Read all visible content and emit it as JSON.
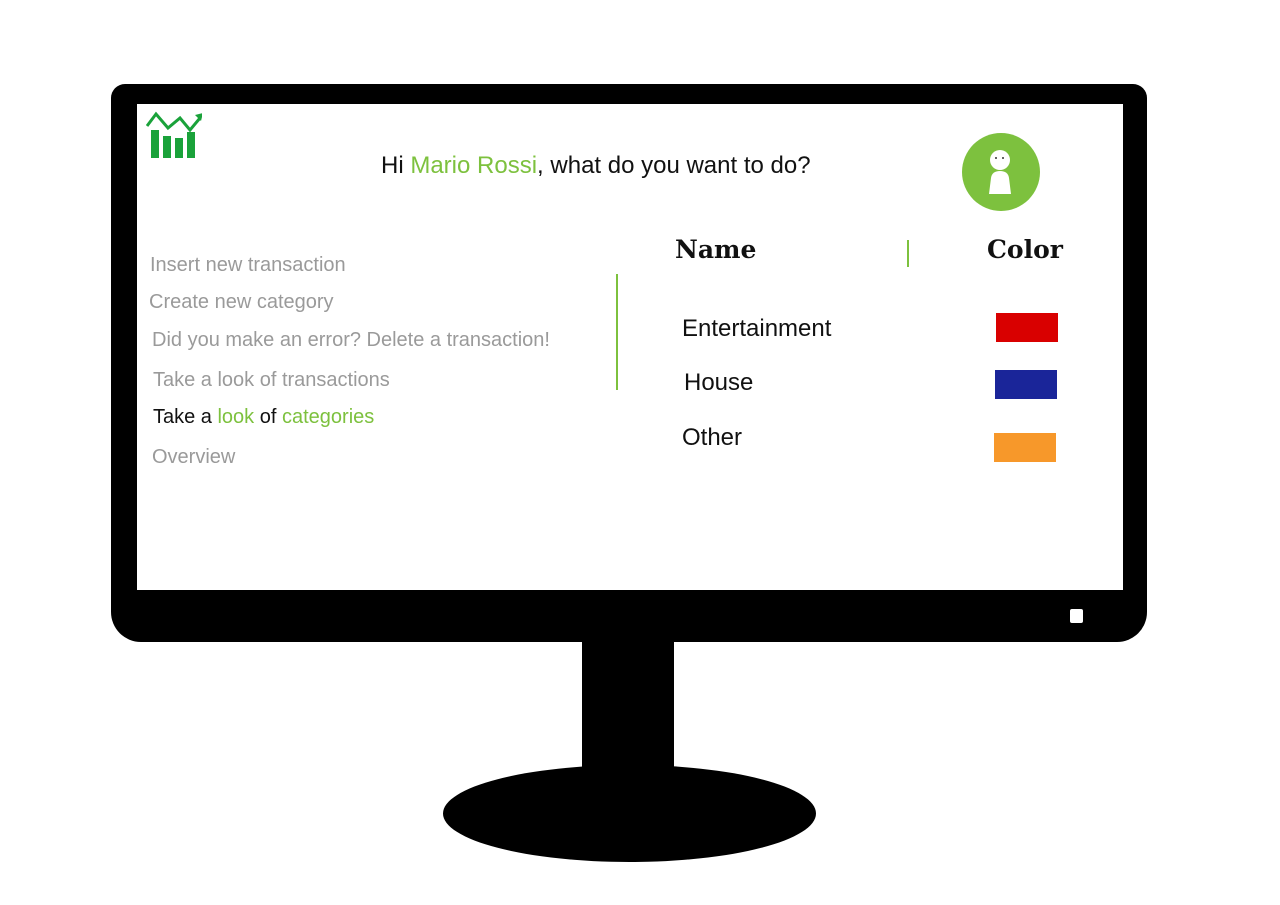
{
  "app": {
    "logo_icon": "bar-chart-growth-icon",
    "accent_color": "#7dc13e"
  },
  "header": {
    "greeting_prefix": "Hi ",
    "user_name": "Mario Rossi",
    "greeting_suffix": ", what do you want to do?",
    "avatar_icon": "user-avatar-icon"
  },
  "menu": {
    "items": [
      {
        "label": "Insert new transaction"
      },
      {
        "label": "Create new category"
      },
      {
        "label": "Did you make an error? Delete a transaction!"
      },
      {
        "label": "Take a look of transactions"
      },
      {
        "label_part1": "Take a ",
        "label_part2": "look",
        "label_part3": " of ",
        "label_part4": "categories",
        "active": true
      },
      {
        "label": "Overview"
      }
    ]
  },
  "table": {
    "headers": {
      "name": "Name",
      "color": "Color"
    },
    "rows": [
      {
        "name": "Entertainment",
        "color": "#d90000"
      },
      {
        "name": "House",
        "color": "#1a2599"
      },
      {
        "name": "Other",
        "color": "#f7982a"
      }
    ]
  }
}
